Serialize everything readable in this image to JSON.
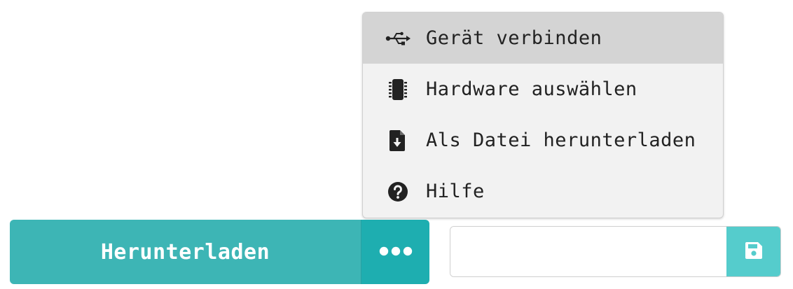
{
  "menu": {
    "items": [
      {
        "label": "Gerät verbinden",
        "icon": "usb-icon",
        "highlighted": true
      },
      {
        "label": "Hardware auswählen",
        "icon": "chip-icon",
        "highlighted": false
      },
      {
        "label": "Als Datei herunterladen",
        "icon": "file-download-icon",
        "highlighted": false
      },
      {
        "label": "Hilfe",
        "icon": "help-circle-icon",
        "highlighted": false
      }
    ]
  },
  "download": {
    "label": "Herunterladen",
    "more_icon": "more-dots-icon"
  },
  "file": {
    "value": "",
    "save_icon": "save-icon"
  },
  "colors": {
    "primary": "#3db5b5",
    "primary_dark": "#1eaeb0",
    "save": "#55cccc",
    "menu_bg": "#f2f2f2",
    "menu_highlight": "#d4d4d4"
  }
}
